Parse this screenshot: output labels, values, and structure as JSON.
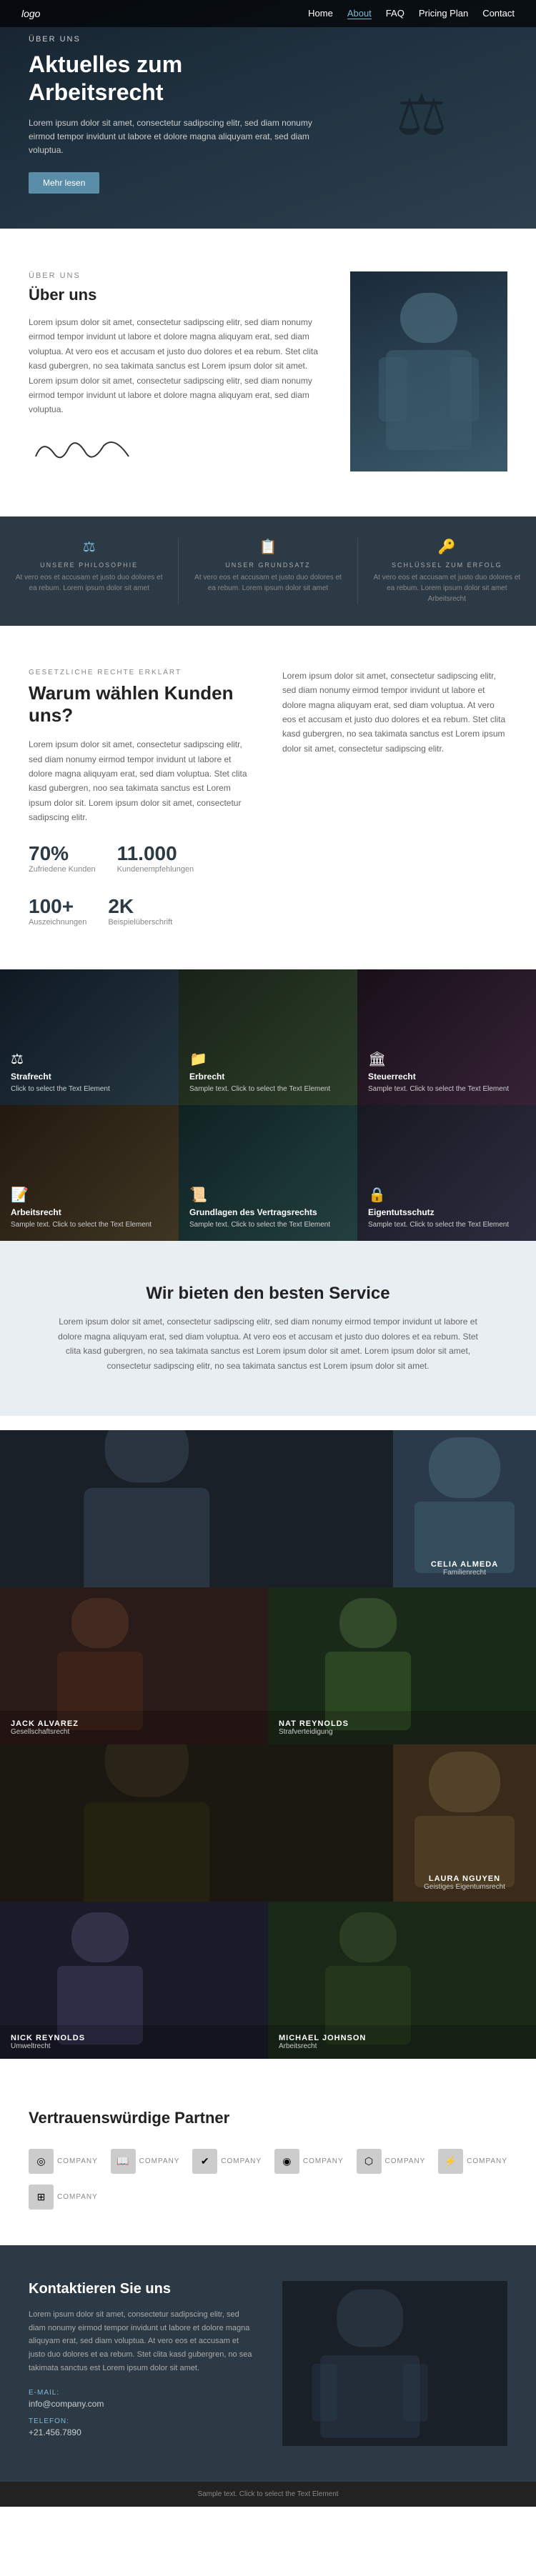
{
  "nav": {
    "logo": "logo",
    "items": [
      {
        "label": "Home",
        "active": false
      },
      {
        "label": "About",
        "active": true
      },
      {
        "label": "FAQ",
        "active": false
      },
      {
        "label": "Pricing Plan",
        "active": false
      },
      {
        "label": "Contact",
        "active": false
      }
    ]
  },
  "hero": {
    "label": "ÜBER UNS",
    "title": "Aktuelles zum Arbeitsrecht",
    "text": "Lorem ipsum dolor sit amet, consectetur sadipscing elitr, sed diam nonumy eirmod tempor invidunt ut labore et dolore magna aliquyam erat, sed diam voluptua.",
    "button_label": "Mehr lesen"
  },
  "about": {
    "label": "Über uns",
    "title": "Über uns",
    "text": "Lorem ipsum dolor sit amet, consectetur sadipscing elitr, sed diam nonumy eirmod tempor invidunt ut labore et dolore magna aliquyam erat, sed diam voluptua. At vero eos et accusam et justo duo dolores et ea rebum. Stet clita kasd gubergren, no sea takimata sanctus est Lorem ipsum dolor sit amet. Lorem ipsum dolor sit amet, consectetur sadipscing elitr, sed diam nonumy eirmod tempor invidunt ut labore et dolore magna aliquyam erat, sed diam voluptua.",
    "signature": "A. Johnson"
  },
  "philosophy": {
    "items": [
      {
        "icon": "⚖",
        "label": "UNSERE PHILOSOPHIE",
        "text": "At vero eos et accusam et justo duo dolores et ea rebum. Lorem ipsum dolor sit amet"
      },
      {
        "icon": "📋",
        "label": "UNSER GRUNDSATZ",
        "text": "At vero eos et accusam et justo duo dolores et ea rebum. Lorem ipsum dolor sit amet"
      },
      {
        "icon": "🔑",
        "label": "SCHLÜSSEL ZUM ERFOLG",
        "text": "At vero eos et accusam et justo duo dolores et ea rebum. Lorem ipsum dolor sit amet Arbeitsrecht"
      }
    ]
  },
  "why": {
    "label": "GESETZLICHE RECHTE ERKLÄRT",
    "title": "Warum wählen Kunden uns?",
    "left_text": "Lorem ipsum dolor sit amet, consectetur sadipscing elitr, sed diam nonumy eirmod tempor invidunt ut labore et dolore magna aliquyam erat, sed diam voluptua. Stet clita kasd gubergren, noo sea takimata sanctus est Lorem ipsum dolor sit. Lorem ipsum dolor sit amet, consectetur sadipscing elitr.",
    "right_text": "Lorem ipsum dolor sit amet, consectetur sadipscing elitr, sed diam nonumy eirmod tempor invidunt ut labore et dolore magna aliquyam erat, sed diam voluptua. At vero eos et accusam et justo duo dolores et ea rebum. Stet clita kasd gubergren, no sea takimata sanctus est Lorem ipsum dolor sit amet, consectetur sadipscing elitr.",
    "stats": [
      {
        "number": "70%",
        "label": "Zufriedene Kunden"
      },
      {
        "number": "11.000",
        "label": "Kundenempfehlungen"
      },
      {
        "number": "100+",
        "label": "Auszeichnungen"
      },
      {
        "number": "2K",
        "label": "Beispielüberschrift"
      }
    ]
  },
  "practice": {
    "items": [
      {
        "icon": "⚖",
        "title": "Strafrecht",
        "text": "Click to select the Text Element",
        "bg": "bg1"
      },
      {
        "icon": "📁",
        "title": "Erbrecht",
        "text": "Sample text. Click to select the Text Element",
        "bg": "bg2"
      },
      {
        "icon": "🏛",
        "title": "Steuerrecht",
        "text": "Sample text. Click to select the Text Element",
        "bg": "bg3"
      },
      {
        "icon": "📝",
        "title": "Arbeitsrecht",
        "text": "Sample text. Click to select the Text Element",
        "bg": "bg4"
      },
      {
        "icon": "📜",
        "title": "Grundlagen des Vertragsrechts",
        "text": "Sample text. Click to select the Text Element",
        "bg": "bg5"
      },
      {
        "icon": "🔒",
        "title": "Eigentutsschutz",
        "text": "Sample text. Click to select the Text Element",
        "bg": "bg6"
      }
    ]
  },
  "service": {
    "title": "Wir bieten den besten Service",
    "text": "Lorem ipsum dolor sit amet, consectetur sadipscing elitr, sed diam nonumy eirmod tempor invidunt ut labore et dolore magna aliquyam erat, sed diam voluptua. At vero eos et accusam et justo duo dolores et ea rebum. Stet clita kasd gubergren, no sea takimata sanctus est Lorem ipsum dolor sit amet. Lorem ipsum dolor sit amet, consectetur sadipscing elitr, no sea takimata sanctus est Lorem ipsum dolor sit amet."
  },
  "team": {
    "items": [
      {
        "name": "CELIA ALMEDA",
        "role": "Familienrecht",
        "layout": "wide",
        "bg": "team-t1"
      },
      {
        "name": "JACK ALVAREZ",
        "role": "Gesellschaftsrecht",
        "layout": "normal",
        "bg": "team-t2"
      },
      {
        "name": "NAT REYNOLDS",
        "role": "Strafverteidigung",
        "layout": "normal",
        "bg": "team-t3"
      },
      {
        "name": "LAURA NGUYEN",
        "role": "Geistiges Eigentumsrecht",
        "layout": "wide",
        "bg": "team-t4"
      },
      {
        "name": "NICK REYNOLDS",
        "role": "Umweltrecht",
        "layout": "normal",
        "bg": "team-t5"
      },
      {
        "name": "MICHAEL JOHNSON",
        "role": "Arbeitsrecht",
        "layout": "normal",
        "bg": "team-t6"
      }
    ]
  },
  "partners": {
    "title": "Vertrauenswürdige Partner",
    "items": [
      {
        "icon": "◎",
        "name": "COMPANY"
      },
      {
        "icon": "📖",
        "name": "COMPANY"
      },
      {
        "icon": "✔",
        "name": "COMPANY"
      },
      {
        "icon": "◉",
        "name": "COMPANY"
      },
      {
        "icon": "⬡",
        "name": "COMPANY"
      },
      {
        "icon": "⚡",
        "name": "COMPANY"
      },
      {
        "icon": "⊞",
        "name": "COMPANY"
      }
    ]
  },
  "contact": {
    "title": "Kontaktieren Sie uns",
    "text": "Lorem ipsum dolor sit amet, consectetur sadipscing elitr, sed diam nonumy eirmod tempor invidunt ut labore et dolore magna aliquyam erat, sed diam voluptua. At vero eos et accusam et justo duo dolores et ea rebum. Stet clita kasd gubergren, no sea takimata sanctus est Lorem ipsum dolor sit amet.",
    "email_label": "E-Mail:",
    "email_value": "info@company.com",
    "phone_label": "Telefon:",
    "phone_value": "+21.456.7890"
  },
  "footer": {
    "sample_text": "Sample text. Click to select the Text Element"
  }
}
